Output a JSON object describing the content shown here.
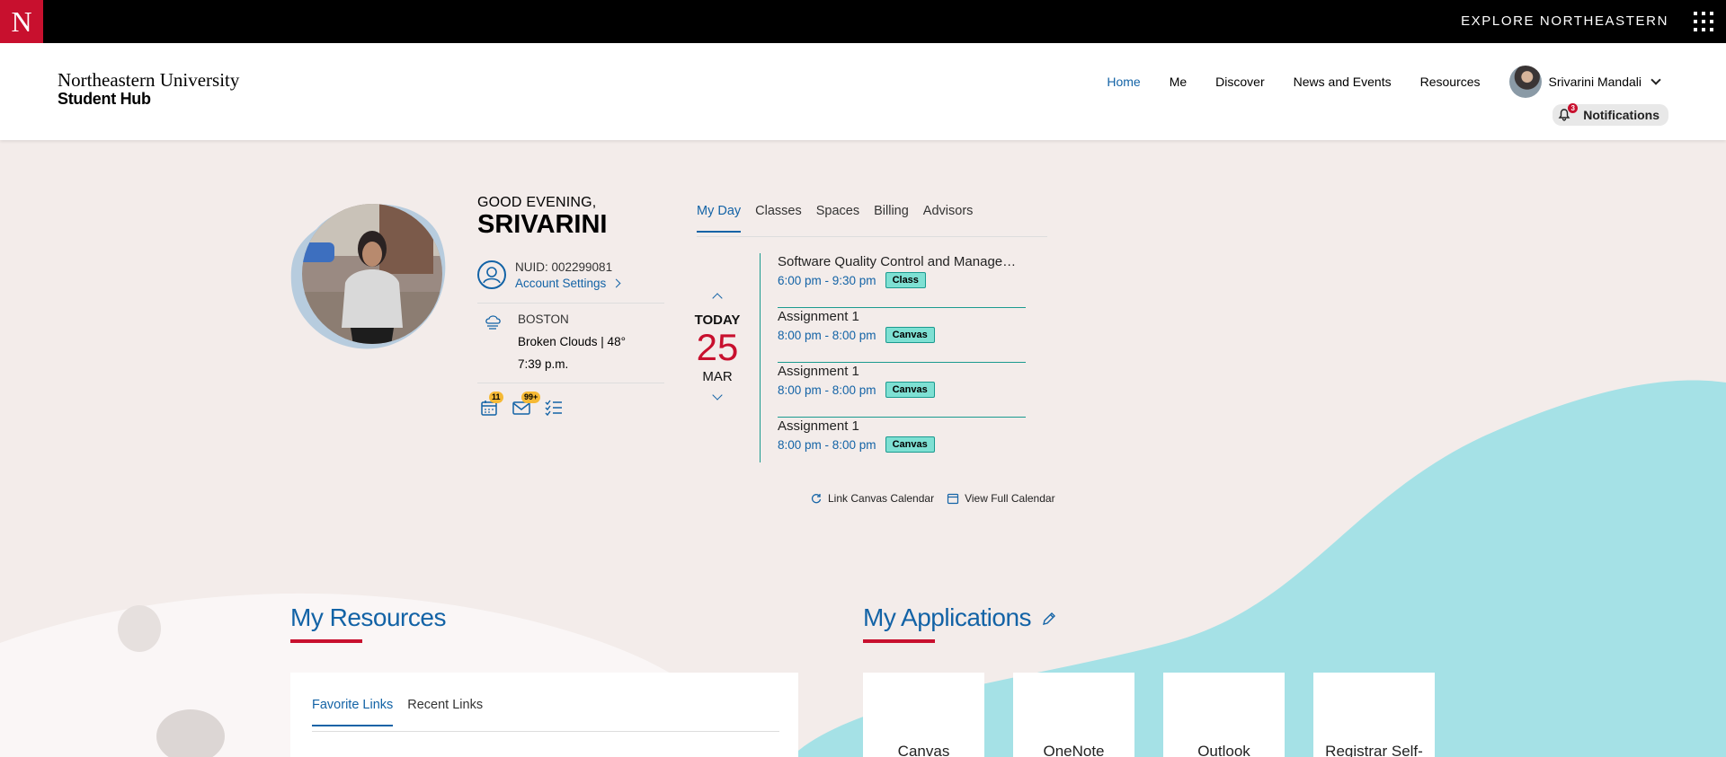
{
  "topbar": {
    "logo_letter": "N",
    "explore_label": "EXPLORE NORTHEASTERN"
  },
  "header": {
    "brand_line1": "Northeastern University",
    "brand_line2": "Student Hub",
    "nav": [
      "Home",
      "Me",
      "Discover",
      "News and Events",
      "Resources"
    ],
    "active_nav": "Home",
    "user_name": "Srivarini Mandali",
    "notifications_label": "Notifications",
    "notifications_count": "3"
  },
  "profile": {
    "greeting": "GOOD EVENING,",
    "name": "SRIVARINI",
    "nuid": "NUID: 002299081",
    "account_settings": "Account Settings",
    "city": "BOSTON",
    "conditions": "Broken Clouds | 48°",
    "time": "7:39 p.m.",
    "calendar_badge": "11",
    "mail_badge": "99+"
  },
  "myday": {
    "tabs": [
      "My Day",
      "Classes",
      "Spaces",
      "Billing",
      "Advisors"
    ],
    "active_tab": "My Day",
    "today_label": "TODAY",
    "day": "25",
    "month": "MAR",
    "events": [
      {
        "title": "Software Quality Control and Management",
        "time": "6:00 pm - 9:30 pm",
        "tag": "Class"
      },
      {
        "title": "Assignment 1",
        "time": "8:00 pm - 8:00 pm",
        "tag": "Canvas"
      },
      {
        "title": "Assignment 1",
        "time": "8:00 pm - 8:00 pm",
        "tag": "Canvas"
      },
      {
        "title": "Assignment 1",
        "time": "8:00 pm - 8:00 pm",
        "tag": "Canvas"
      }
    ],
    "link_canvas": "Link Canvas Calendar",
    "view_calendar": "View Full Calendar"
  },
  "resources": {
    "title": "My Resources",
    "tabs": [
      "Favorite Links",
      "Recent Links"
    ],
    "active_tab": "Favorite Links"
  },
  "applications": {
    "title": "My Applications",
    "apps": [
      "Canvas",
      "OneNote",
      "Outlook",
      "Registrar Self-"
    ]
  },
  "colors": {
    "brand_red": "#c8102e",
    "link_blue": "#1363a6",
    "teal": "#a5e1e6",
    "tag_teal": "#7ee0d3",
    "page_bg": "#f3ecea"
  }
}
